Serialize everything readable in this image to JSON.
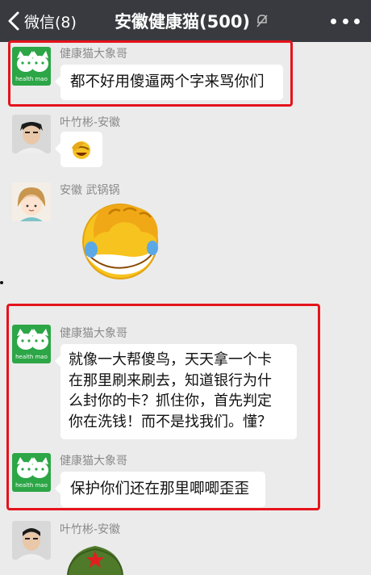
{
  "header": {
    "back_label": "微信(8)",
    "title": "安徽健康猫(500)",
    "icons": [
      "chevron-left-icon",
      "voice-mute-icon",
      "more-dots-icon"
    ]
  },
  "colors": {
    "header_bg": "#393a3f",
    "chat_bg": "#ebebeb",
    "bubble_bg": "#ffffff",
    "highlight": "#e5131c",
    "cat_avatar_bg": "#2ca646"
  },
  "messages": [
    {
      "sender": "健康猫大象哥",
      "avatar": "green-cat-logo",
      "avatar_text": "health mao",
      "type": "text",
      "text": "都不好用傻逼两个字来骂你们"
    },
    {
      "sender": "叶竹彬-安徽",
      "avatar": "man-photo",
      "type": "emoji",
      "emoji": "small-laughing-emoji"
    },
    {
      "sender": "安徽 武锅锅",
      "avatar": "cartoon-girl",
      "type": "sticker",
      "emoji": "facepalm-laughing-emoji"
    },
    {
      "sender": "健康猫大象哥",
      "avatar": "green-cat-logo",
      "avatar_text": "health mao",
      "type": "text",
      "text": "就像一大帮傻鸟，天天拿一个卡\n在那里刷来刷去，知道银行为什\n么封你的卡？抓住你，首先判定\n你在洗钱！而不是找我们。懂？"
    },
    {
      "sender": "健康猫大象哥",
      "avatar": "green-cat-logo",
      "avatar_text": "health mao",
      "type": "text",
      "text": "保护你们还在那里唧唧歪歪"
    },
    {
      "sender": "叶竹彬-安徽",
      "avatar": "man-photo",
      "type": "sticker",
      "emoji": "soldier-cap-emoji"
    }
  ]
}
